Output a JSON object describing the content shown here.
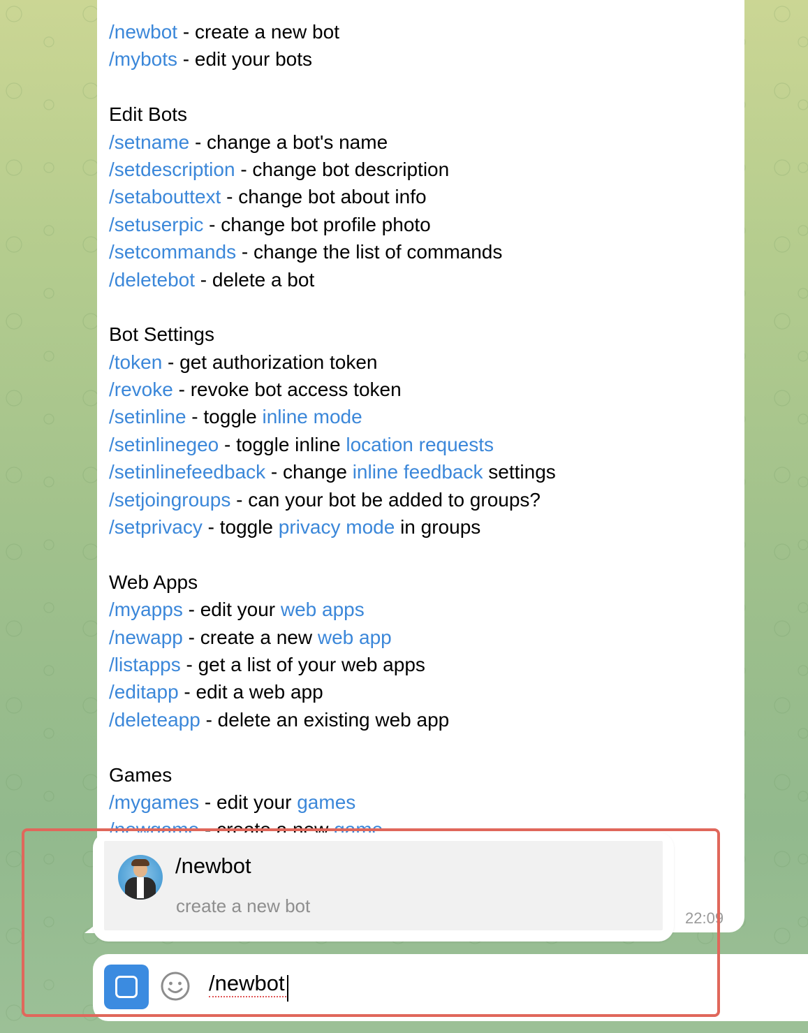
{
  "message": {
    "lines": [
      [
        {
          "t": "/newbot",
          "k": "cmd"
        },
        {
          "t": " - create a new bot",
          "k": "text"
        }
      ],
      [
        {
          "t": "/mybots",
          "k": "cmd"
        },
        {
          "t": " - edit your bots",
          "k": "text"
        }
      ],
      [],
      [
        {
          "t": "Edit Bots",
          "k": "text"
        }
      ],
      [
        {
          "t": "/setname",
          "k": "cmd"
        },
        {
          "t": " - change a bot's name",
          "k": "text"
        }
      ],
      [
        {
          "t": "/setdescription",
          "k": "cmd"
        },
        {
          "t": " - change bot description",
          "k": "text"
        }
      ],
      [
        {
          "t": "/setabouttext",
          "k": "cmd"
        },
        {
          "t": " - change bot about info",
          "k": "text"
        }
      ],
      [
        {
          "t": "/setuserpic",
          "k": "cmd"
        },
        {
          "t": " - change bot profile photo",
          "k": "text"
        }
      ],
      [
        {
          "t": "/setcommands",
          "k": "cmd"
        },
        {
          "t": " - change the list of commands",
          "k": "text"
        }
      ],
      [
        {
          "t": "/deletebot",
          "k": "cmd"
        },
        {
          "t": " - delete a bot",
          "k": "text"
        }
      ],
      [],
      [
        {
          "t": "Bot Settings",
          "k": "text"
        }
      ],
      [
        {
          "t": "/token",
          "k": "cmd"
        },
        {
          "t": " - get authorization token",
          "k": "text"
        }
      ],
      [
        {
          "t": "/revoke",
          "k": "cmd"
        },
        {
          "t": " - revoke bot access token",
          "k": "text"
        }
      ],
      [
        {
          "t": "/setinline",
          "k": "cmd"
        },
        {
          "t": " - toggle ",
          "k": "text"
        },
        {
          "t": "inline mode",
          "k": "link"
        }
      ],
      [
        {
          "t": "/setinlinegeo",
          "k": "cmd"
        },
        {
          "t": " - toggle inline ",
          "k": "text"
        },
        {
          "t": "location requests",
          "k": "link"
        }
      ],
      [
        {
          "t": "/setinlinefeedback",
          "k": "cmd"
        },
        {
          "t": " - change ",
          "k": "text"
        },
        {
          "t": "inline feedback",
          "k": "link"
        },
        {
          "t": " settings",
          "k": "text"
        }
      ],
      [
        {
          "t": "/setjoingroups",
          "k": "cmd"
        },
        {
          "t": " - can your bot be added to groups?",
          "k": "text"
        }
      ],
      [
        {
          "t": "/setprivacy",
          "k": "cmd"
        },
        {
          "t": " - toggle ",
          "k": "text"
        },
        {
          "t": "privacy mode",
          "k": "link"
        },
        {
          "t": " in groups",
          "k": "text"
        }
      ],
      [],
      [
        {
          "t": "Web Apps",
          "k": "text"
        }
      ],
      [
        {
          "t": "/myapps",
          "k": "cmd"
        },
        {
          "t": " - edit your ",
          "k": "text"
        },
        {
          "t": "web apps",
          "k": "link"
        }
      ],
      [
        {
          "t": "/newapp",
          "k": "cmd"
        },
        {
          "t": " - create a new ",
          "k": "text"
        },
        {
          "t": "web app",
          "k": "link"
        }
      ],
      [
        {
          "t": "/listapps",
          "k": "cmd"
        },
        {
          "t": " - get a list of your web apps",
          "k": "text"
        }
      ],
      [
        {
          "t": "/editapp",
          "k": "cmd"
        },
        {
          "t": " - edit a web app",
          "k": "text"
        }
      ],
      [
        {
          "t": "/deleteapp",
          "k": "cmd"
        },
        {
          "t": " - delete an existing web app",
          "k": "text"
        }
      ],
      [],
      [
        {
          "t": "Games",
          "k": "text"
        }
      ],
      [
        {
          "t": "/mygames",
          "k": "cmd"
        },
        {
          "t": " - edit your ",
          "k": "text"
        },
        {
          "t": "games",
          "k": "link"
        }
      ],
      [
        {
          "t": "/newgame",
          "k": "cmd"
        },
        {
          "t": " - create a new ",
          "k": "text"
        },
        {
          "t": "game",
          "k": "link"
        }
      ]
    ],
    "timestamp": "22:09"
  },
  "suggestion": {
    "command": "/newbot",
    "description": "create a new bot"
  },
  "composer": {
    "value": "/newbot",
    "menu_icon": "bot-menu-icon",
    "emoji_icon": "emoji-icon"
  },
  "colors": {
    "command": "#3b87d9",
    "menu_button": "#3b8be0",
    "highlight_box": "#e0675b"
  }
}
